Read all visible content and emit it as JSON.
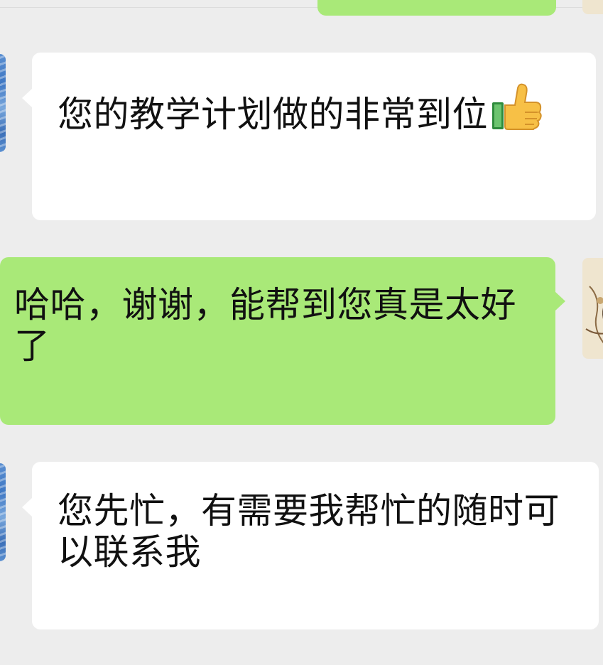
{
  "messages": [
    {
      "direction": "incoming",
      "text": "您的教学计划做的非常到位",
      "emoji": "thumbs-up"
    },
    {
      "direction": "outgoing",
      "text": "哈哈，谢谢，能帮到您真是太好了"
    },
    {
      "direction": "incoming",
      "text": "您先忙，有需要我帮忙的随时可以联系我"
    }
  ],
  "colors": {
    "background": "#ededed",
    "incoming_bubble": "#ffffff",
    "outgoing_bubble": "#a9e978",
    "text": "#111111"
  }
}
